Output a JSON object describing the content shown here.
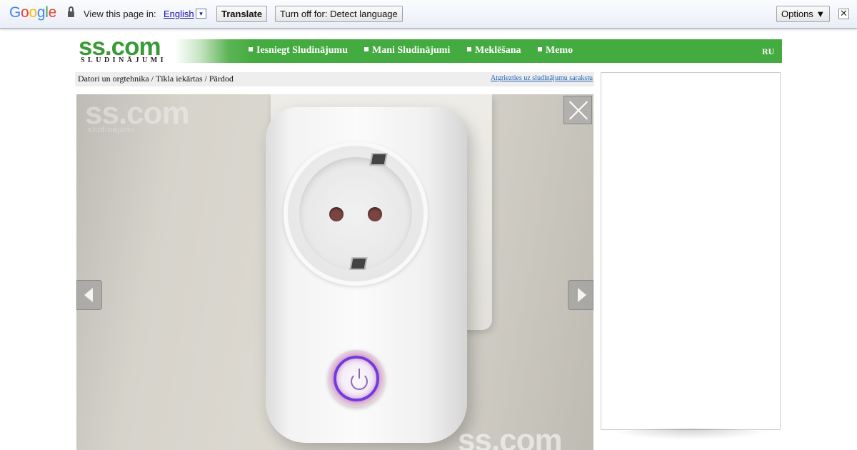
{
  "translate_bar": {
    "logo_letters": [
      "G",
      "o",
      "o",
      "g",
      "l",
      "e"
    ],
    "logo_colors": [
      "#4285f4",
      "#ea4335",
      "#fbbc05",
      "#4285f4",
      "#34a853",
      "#ea4335"
    ],
    "prompt": "View this page in:",
    "language": "English",
    "language_dropdown_glyph": "▾",
    "translate_button": "Translate",
    "turn_off_button": "Turn off for: Detect language",
    "options_button": "Options ▼",
    "close_glyph": "✕",
    "icons": {
      "lock": "lock-icon",
      "close": "close-icon"
    }
  },
  "header": {
    "logo_main": "ss.com",
    "logo_sub": "SLUDINĀJUMI",
    "nav": [
      {
        "label": "Iesniegt Sludinājumu"
      },
      {
        "label": "Mani Sludinājumi"
      },
      {
        "label": "Meklēšana"
      },
      {
        "label": "Memo"
      }
    ],
    "language_switch": "RU",
    "accent_color": "#43ab3f"
  },
  "breadcrumb": {
    "path": "Datori un orgtehnika / Tīkla iekārtas / Pārdod",
    "back_link": "Atgriezties uz sludinājumu sarakstu"
  },
  "photo_viewer": {
    "watermark_top": "ss.com",
    "watermark_top_sub": "sludinājumi",
    "watermark_bottom": "ss.com",
    "icons": {
      "close": "close-icon",
      "prev": "chevron-left-icon",
      "next": "chevron-right-icon"
    }
  },
  "ad_panel": {}
}
